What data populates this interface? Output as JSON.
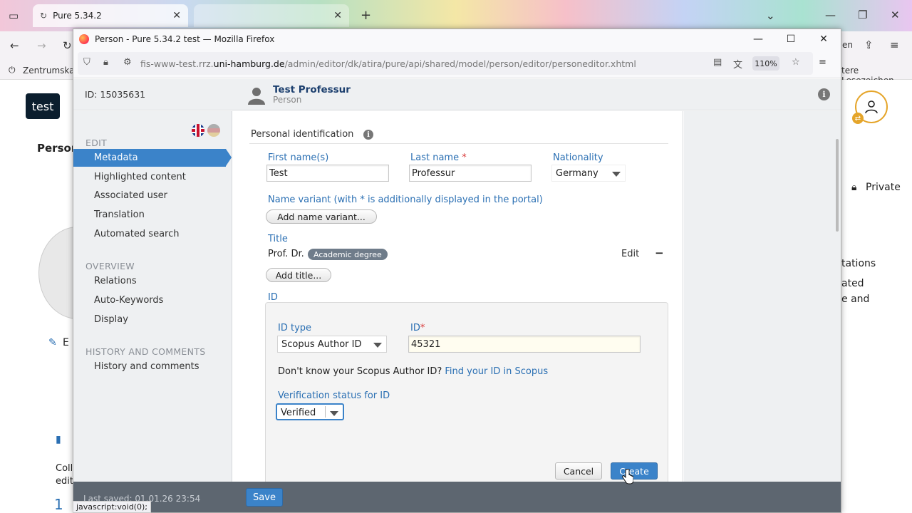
{
  "outer": {
    "tab1_title": "Pure 5.34.2",
    "tab2_title": "",
    "bookmark_left": "Zentrumskan",
    "bookmark_right": "tere Lesezeichen",
    "en_text": "en",
    "badge_test": "test",
    "person_partial": "Persor",
    "edit_partial": "E",
    "private_label": "Private",
    "right_texts": [
      "tations",
      "ated",
      "e and"
    ],
    "coll_text": "Coll",
    "edit_text": "edit",
    "one_text": "1"
  },
  "window": {
    "title": "Person - Pure 5.34.2 test — Mozilla Firefox",
    "url_prefix": "fis-www-test.rrz.",
    "url_domain": "uni-hamburg.de",
    "url_path": "/admin/editor/dk/atira/pure/api/shared/model/person/editor/personeditor.xhtml",
    "zoom": "110%"
  },
  "header": {
    "id_label": "ID: 15035631",
    "name": "Test Professur",
    "type": "Person"
  },
  "sidebar": {
    "edit_section": "EDIT",
    "edit_items": [
      "Metadata",
      "Highlighted content",
      "Associated user",
      "Translation",
      "Automated search"
    ],
    "overview_section": "OVERVIEW",
    "overview_items": [
      "Relations",
      "Auto-Keywords",
      "Display"
    ],
    "history_section": "HISTORY AND COMMENTS",
    "history_items": [
      "History and comments"
    ]
  },
  "form": {
    "section_title": "Personal identification",
    "first_name_label": "First name(s)",
    "first_name_value": "Test",
    "last_name_label": "Last name",
    "last_name_value": "Professur",
    "required_mark": "*",
    "nationality_label": "Nationality",
    "nationality_value": "Germany",
    "name_variant_label": "Name variant (with * is additionally displayed in the portal)",
    "add_name_variant": "Add name variant...",
    "title_label": "Title",
    "title_value": "Prof. Dr.",
    "title_badge": "Academic degree",
    "edit_link": "Edit",
    "remove_symbol": "−",
    "add_title": "Add title...",
    "id_section": "ID",
    "id_type_label": "ID type",
    "id_type_value": "Scopus Author ID",
    "id_label": "ID",
    "id_value": "45321",
    "scopus_question": "Don't know your Scopus Author ID?",
    "scopus_link": "Find your ID in Scopus",
    "verification_label": "Verification status for ID",
    "verification_value": "Verified",
    "cancel": "Cancel",
    "create": "Create"
  },
  "footer": {
    "last_saved": "Last saved: 01.01.26 23:54",
    "save": "Save",
    "status_tip": "javascript:void(0);"
  }
}
